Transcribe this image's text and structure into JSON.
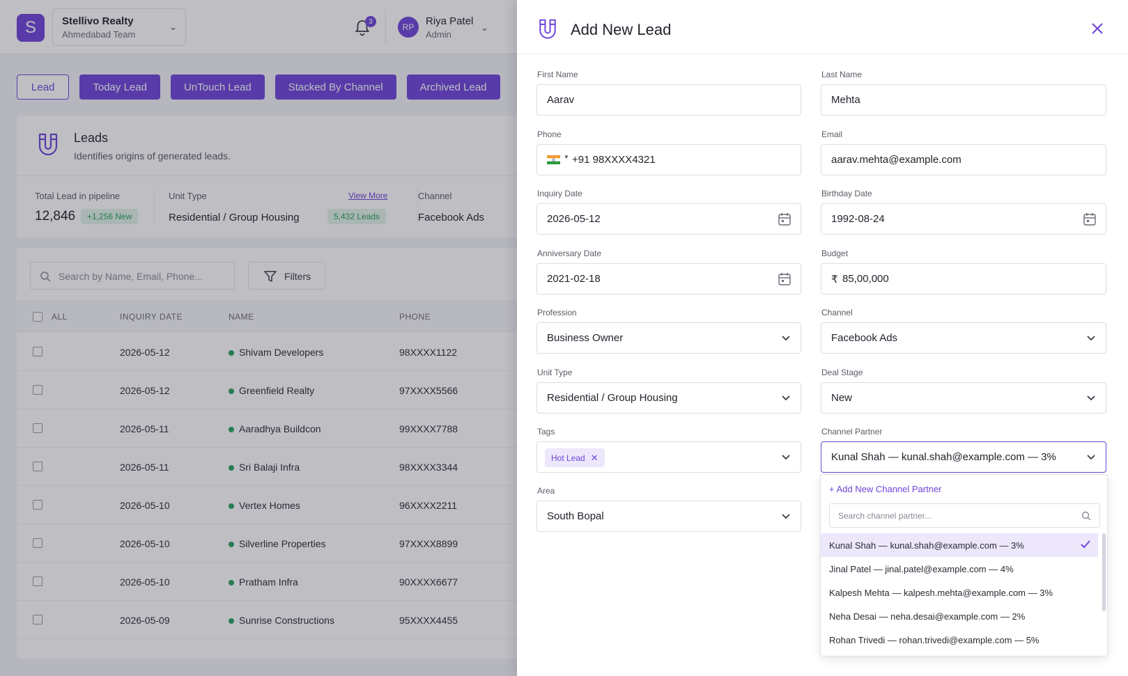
{
  "header": {
    "logo_letter": "S",
    "org_name": "Stellivo Realty",
    "org_team": "Ahmedabad Team",
    "notification_count": "3",
    "user_initials": "RP",
    "user_name": "Riya Patel",
    "user_role": "Admin"
  },
  "tabs": [
    "Lead",
    "Today Lead",
    "UnTouch Lead",
    "Stacked By Channel",
    "Archived Lead"
  ],
  "leads_card": {
    "title": "Leads",
    "subtitle": "Identifies origins of generated leads.",
    "total_label": "Total Lead in pipeline",
    "total_value": "12,846",
    "total_new": "+1,256 New",
    "unit_label": "Unit Type",
    "unit_value": "Residential / Group Housing",
    "unit_count": "5,432 Leads",
    "view_more": "View More",
    "channel_label": "Channel",
    "channel_value": "Facebook Ads"
  },
  "table": {
    "search_placeholder": "Search by Name, Email, Phone...",
    "filters_label": "Filters",
    "columns": [
      "ALL",
      "INQUIRY DATE",
      "NAME",
      "PHONE"
    ],
    "rows": [
      {
        "date": "2026-05-12",
        "name": "Shivam Developers",
        "phone": "98XXXX1122"
      },
      {
        "date": "2026-05-12",
        "name": "Greenfield Realty",
        "phone": "97XXXX5566"
      },
      {
        "date": "2026-05-11",
        "name": "Aaradhya Buildcon",
        "phone": "99XXXX7788"
      },
      {
        "date": "2026-05-11",
        "name": "Sri Balaji Infra",
        "phone": "98XXXX3344"
      },
      {
        "date": "2026-05-10",
        "name": "Vertex Homes",
        "phone": "96XXXX2211"
      },
      {
        "date": "2026-05-10",
        "name": "Silverline Properties",
        "phone": "97XXXX8899"
      },
      {
        "date": "2026-05-10",
        "name": "Pratham Infra",
        "phone": "90XXXX6677"
      },
      {
        "date": "2026-05-09",
        "name": "Sunrise Constructions",
        "phone": "95XXXX4455"
      }
    ]
  },
  "drawer": {
    "title": "Add New Lead",
    "fields": {
      "first_name": {
        "label": "First Name",
        "value": "Aarav"
      },
      "last_name": {
        "label": "Last Name",
        "value": "Mehta"
      },
      "phone": {
        "label": "Phone",
        "value": "+91 98XXXX4321"
      },
      "email": {
        "label": "Email",
        "value": "aarav.mehta@example.com"
      },
      "inquiry_date": {
        "label": "Inquiry Date",
        "value": "2026-05-12"
      },
      "birthday_date": {
        "label": "Birthday Date",
        "value": "1992-08-24"
      },
      "anniversary_date": {
        "label": "Anniversary Date",
        "value": "2021-02-18"
      },
      "budget": {
        "label": "Budget",
        "currency": "₹",
        "value": "85,00,000"
      },
      "profession": {
        "label": "Profession",
        "value": "Business Owner"
      },
      "channel": {
        "label": "Channel",
        "value": "Facebook Ads"
      },
      "unit_type": {
        "label": "Unit Type",
        "value": "Residential / Group Housing"
      },
      "deal_stage": {
        "label": "Deal Stage",
        "value": "New"
      },
      "tags": {
        "label": "Tags",
        "chip": "Hot Lead"
      },
      "channel_partner": {
        "label": "Channel Partner",
        "value": "Kunal Shah — kunal.shah@example.com — 3%"
      },
      "area": {
        "label": "Area",
        "value": "South Bopal"
      }
    },
    "partner_dropdown": {
      "add_label": "+ Add New Channel Partner",
      "search_placeholder": "Search channel partner...",
      "options": [
        "Kunal Shah —  kunal.shah@example.com — 3%",
        "Jinal Patel — jinal.patel@example.com — 4%",
        "Kalpesh Mehta — kalpesh.mehta@example.com — 3%",
        "Neha Desai —  neha.desai@example.com — 2%",
        "Rohan Trivedi — rohan.trivedi@example.com — 5%"
      ],
      "selected_index": 0
    }
  },
  "colors": {
    "accent": "#6d44d8",
    "success": "#27a35e"
  }
}
